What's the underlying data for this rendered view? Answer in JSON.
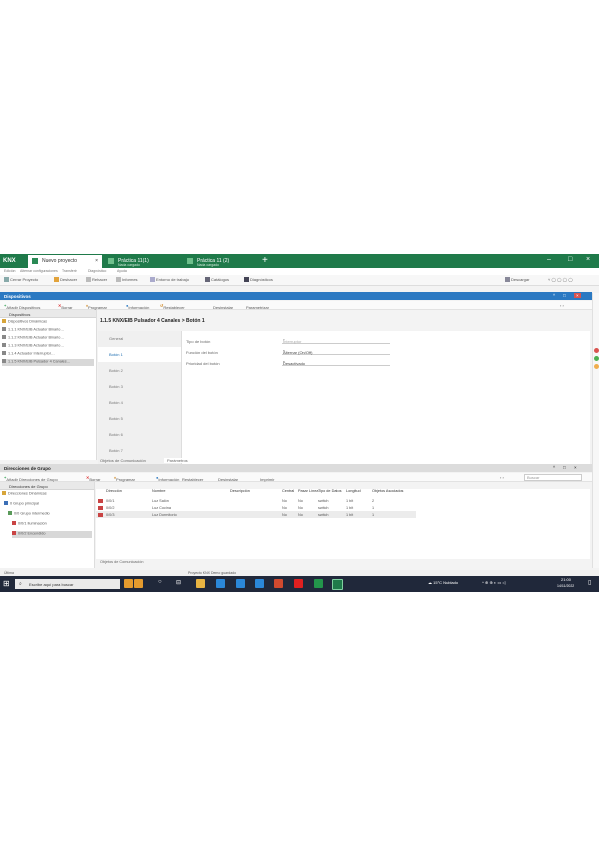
{
  "titlebar": {
    "logo": "KNX",
    "tabs": [
      {
        "label": "Nuevo proyecto",
        "sub": ""
      },
      {
        "label": "Práctica 11(1)",
        "sub": "Nada cargado"
      },
      {
        "label": "Práctica 11 (2)",
        "sub": "Nada cargado"
      }
    ]
  },
  "menubar": [
    "Edición",
    "Alternar configuraciones",
    "Transferir",
    "Diagnóstico",
    "Ayuda"
  ],
  "toolbar": {
    "items": [
      "Cerrar Proyecto",
      "Deshacer",
      "Rehacer",
      "Informes",
      "Entorno de trabajo",
      "Catálogos",
      "Diagnósticos"
    ],
    "right": "Descargar"
  },
  "devices_panel": {
    "title": "Dispositivos",
    "toolbar": [
      "Añadir Dispositivos",
      "Borrar",
      "Programar",
      "Información",
      "Restablecer",
      "Desinstalar",
      "Parametrizar"
    ],
    "tree_header": "Dispositivos",
    "tree": [
      "Dispositivos Dinámicas",
      "1.1.1 KNX/EIB Actuator Binario…",
      "1.1.2 KNX/EIB Actuator Binario…",
      "1.1.3 KNX/EIB Actuator Binario…",
      "1.1.4 Actuador Interruptor…",
      "1.1.5 KNX/EIB Pulsador 4 Canales…"
    ],
    "device_title": "1.1.5 KNX/EIB Pulsador 4 Canales > Botón 1",
    "side_menu": [
      "General",
      "Botón 1",
      "Botón 2",
      "Botón 3",
      "Botón 4",
      "Botón 5",
      "Botón 6",
      "Botón 7"
    ],
    "selected_index": 1,
    "params": [
      {
        "label": "Tipo de botón",
        "value": "Interruptor",
        "disabled": true
      },
      {
        "label": "Función del botón",
        "value": "Alternar (On/Off)",
        "disabled": false
      },
      {
        "label": "Prioridad del botón",
        "value": "Desactivado",
        "disabled": false
      }
    ],
    "bottom_tabs": [
      "Objetos de Comunicación",
      "Parámetros"
    ]
  },
  "group_panel": {
    "title": "Direcciones de Grupo",
    "toolbar": [
      "Añadir Direcciones de Grupo",
      "Borrar",
      "Programar",
      "Información",
      "Restablecer",
      "Desinstalar",
      "Imprimir"
    ],
    "search_placeholder": "Buscar",
    "tree_header": "Direcciones de Grupo",
    "tree": [
      "Direcciones Dinámicas",
      "0 Grupo principal",
      "0/0 Grupo intermedio",
      "0/0/1 Iluminación",
      "0/0/2 Encendido"
    ],
    "columns": [
      "Dirección",
      "Nombre",
      "Descripción",
      "Central",
      "Pasar Línea",
      "Tipo de Datos",
      "Longitud",
      "Objetos Asociados"
    ],
    "rows": [
      [
        "0/0/1",
        "Luz Salón",
        "",
        "No",
        "No",
        "switch",
        "1 bit",
        "2"
      ],
      [
        "0/0/2",
        "Luz Cocina",
        "",
        "No",
        "No",
        "switch",
        "1 bit",
        "1"
      ],
      [
        "0/0/3",
        "Luz Dormitorio",
        "",
        "No",
        "No",
        "switch",
        "1 bit",
        "1"
      ]
    ],
    "footer": "Objetos de Comunicación"
  },
  "statusbar": {
    "left": "Última",
    "center": "Proyecto KNX Demo guardado"
  },
  "taskbar": {
    "search": "Escribe aquí para buscar",
    "weather": "15°C Nublado",
    "time": "21:00",
    "date": "14/11/2022"
  }
}
